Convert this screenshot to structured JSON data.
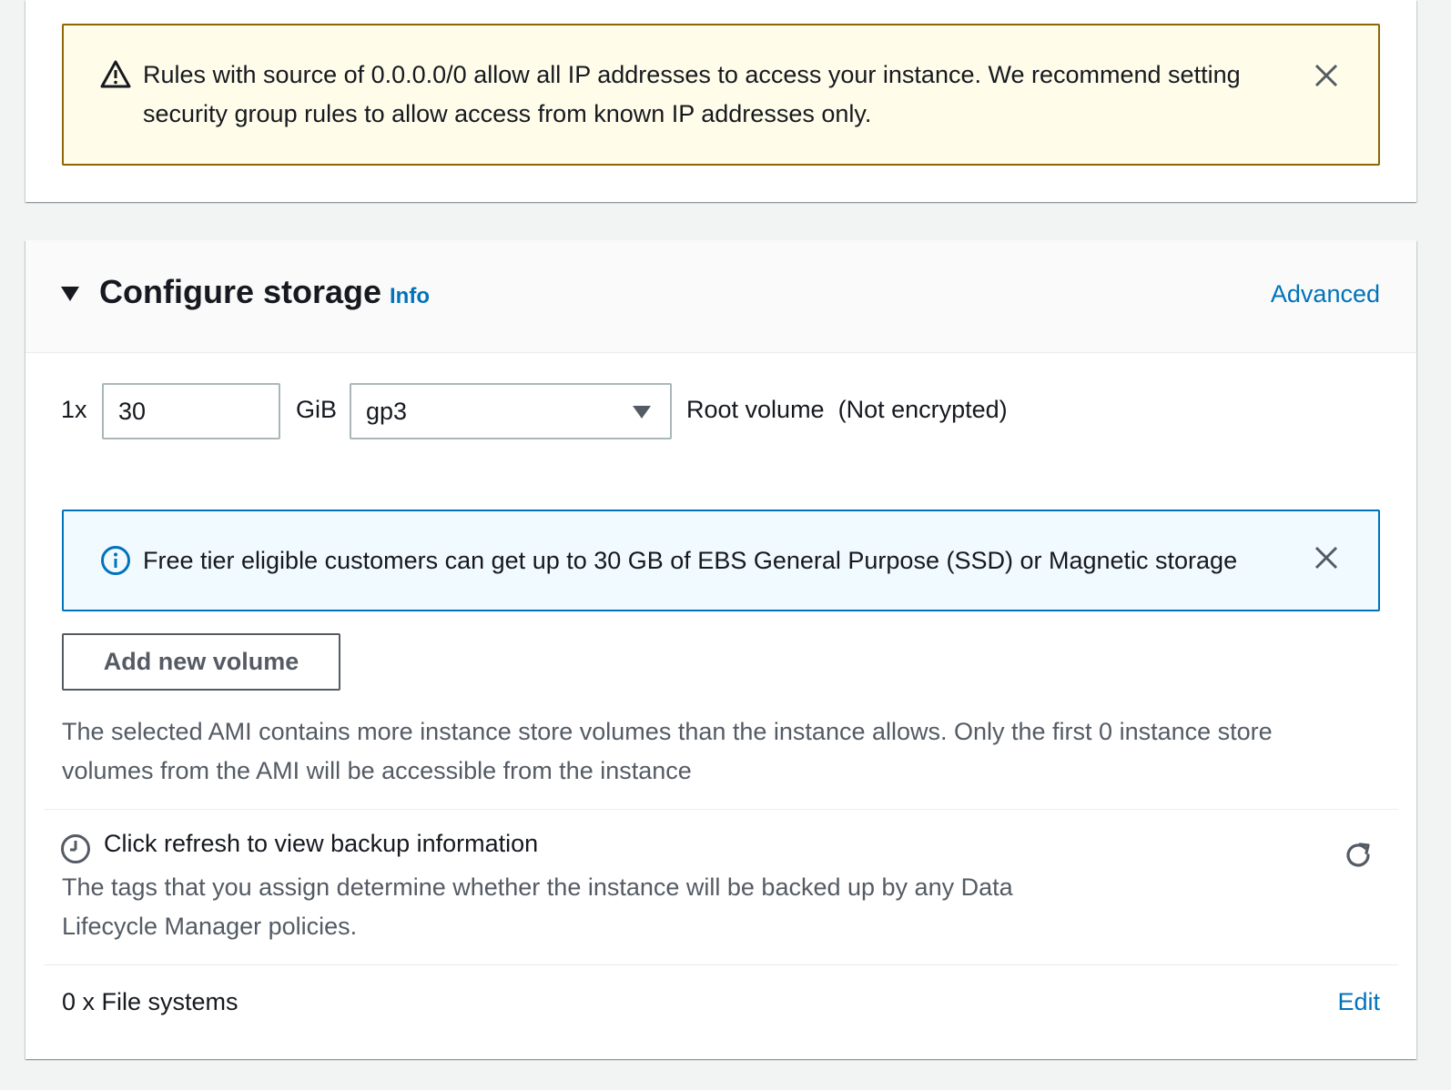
{
  "security_warning": {
    "icon": "warning-icon",
    "text": "Rules with source of 0.0.0.0/0 allow all IP addresses to access your instance. We recommend setting security group rules to allow access from known IP addresses only.",
    "color_border": "#8d6605",
    "color_bg": "#fffce9"
  },
  "storage": {
    "title": "Configure storage",
    "info_label": "Info",
    "advanced_label": "Advanced",
    "volume": {
      "count_label": "1x",
      "size_value": "30",
      "unit_label": "GiB",
      "type_value": "gp3",
      "description": "Root volume  (Not encrypted)"
    },
    "free_tier_notice": {
      "icon": "info-circle-icon",
      "text": "Free tier eligible customers can get up to 30 GB of EBS General Purpose (SSD) or Magnetic storage",
      "color_border": "#0073bb",
      "color_bg": "#f1faff"
    },
    "add_volume_label": "Add new volume",
    "ami_warning": "The selected AMI contains more instance store volumes than the instance allows. Only the first 0 instance store volumes from the AMI will be accessible from the instance",
    "backup": {
      "icon": "clock-icon",
      "title": "Click refresh to view backup information",
      "description": "The tags that you assign determine whether the instance will be backed up by any Data Lifecycle Manager policies."
    },
    "file_systems_label": "0 x File systems",
    "edit_label": "Edit"
  },
  "colors": {
    "link": "#0073bb",
    "page_bg": "#f2f3f3"
  }
}
